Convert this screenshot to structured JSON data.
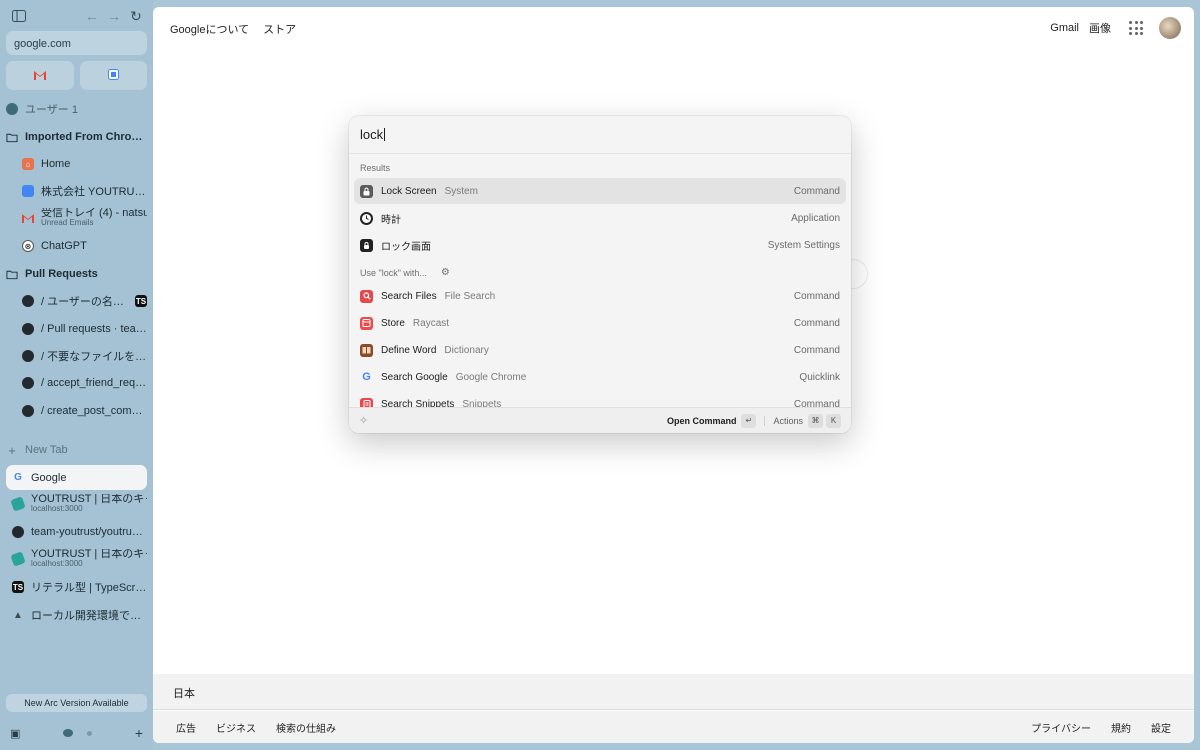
{
  "sidebar": {
    "url": "google.com",
    "profile_label": "ユーザー 1",
    "items": [
      {
        "label": "Imported From Chrome"
      },
      {
        "label": "Home"
      },
      {
        "label": "株式会社 YOUTRUST -..."
      },
      {
        "label": "受信トレイ (4) - natsu...",
        "sub": "Unread Emails"
      },
      {
        "label": "ChatGPT"
      },
      {
        "label": "Pull Requests"
      },
      {
        "label": "/ ユーザーの名前の..."
      },
      {
        "label": "/ Pull requests · team-..."
      },
      {
        "label": "/ 不要なファイルを削除"
      },
      {
        "label": "/ accept_friend_reque..."
      },
      {
        "label": "/ create_post_comma..."
      }
    ],
    "new_tab": "New Tab",
    "tabs": [
      {
        "label": "Google"
      },
      {
        "label": "YOUTRUST | 日本のキャ...",
        "sub": "localhost:3000"
      },
      {
        "label": "team-youtrust/youtrust..."
      },
      {
        "label": "YOUTRUST | 日本のキャ...",
        "sub": "localhost:3000"
      },
      {
        "label": "リテラル型 | TypeScript..."
      },
      {
        "label": "ローカル開発環境でCLW..."
      }
    ],
    "update_label": "New Arc Version Available"
  },
  "google": {
    "header_left": [
      "Googleについて",
      "ストア"
    ],
    "header_right": [
      "Gmail",
      "画像"
    ],
    "country": "日本",
    "footer_left": [
      "広告",
      "ビジネス",
      "検索の仕組み"
    ],
    "footer_right": [
      "プライバシー",
      "規約",
      "設定"
    ]
  },
  "raycast": {
    "query": "lock",
    "results_label": "Results",
    "results": [
      {
        "title": "Lock Screen",
        "sub": "System",
        "acc": "Command",
        "icon": "lock-icon",
        "color": "#5b5b5b"
      },
      {
        "title": "時計",
        "sub": "",
        "acc": "Application",
        "icon": "clock-icon",
        "color": "#222222"
      },
      {
        "title": "ロック画面",
        "sub": "",
        "acc": "System Settings",
        "icon": "lock-screen-settings-icon",
        "color": "#222222"
      }
    ],
    "use_label": "Use \"lock\" with...",
    "fallbacks": [
      {
        "title": "Search Files",
        "sub": "File Search",
        "acc": "Command",
        "icon": "search-files-icon",
        "color": "#e5484d"
      },
      {
        "title": "Store",
        "sub": "Raycast",
        "acc": "Command",
        "icon": "store-icon",
        "color": "#ef4b4b"
      },
      {
        "title": "Define Word",
        "sub": "Dictionary",
        "acc": "Command",
        "icon": "dictionary-icon",
        "color": "#8b4a2b"
      },
      {
        "title": "Search Google",
        "sub": "Google Chrome",
        "acc": "Quicklink",
        "icon": "google-icon",
        "color": "#ffffff"
      },
      {
        "title": "Search Snippets",
        "sub": "Snippets",
        "acc": "Command",
        "icon": "snippets-icon",
        "color": "#e5484d"
      }
    ],
    "primary_action": "Open Command",
    "enter_key": "↵",
    "actions_label": "Actions",
    "cmd_key": "⌘",
    "k_key": "K"
  }
}
